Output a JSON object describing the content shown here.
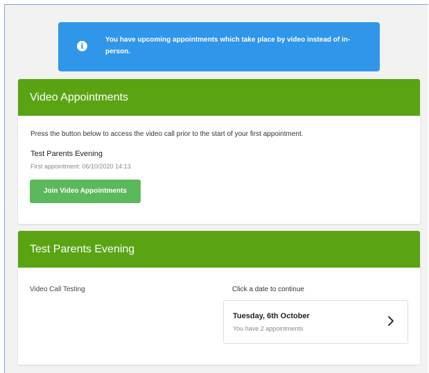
{
  "alert": {
    "icon": "info-icon",
    "icon_glyph": "i",
    "message": "You have upcoming appointments which take place by video instead of in-person."
  },
  "video_card": {
    "title": "Video Appointments",
    "description": "Press the button below to access the video call prior to the start of your first appointment.",
    "event_name": "Test Parents Evening",
    "first_appointment": "First appointment: 06/10/2020 14:13",
    "join_button_label": "Join Video Appointments"
  },
  "evening_card": {
    "title": "Test Parents Evening",
    "left_label": "Video Call Testing",
    "date_prompt": "Click a date to continue",
    "date_option": {
      "date": "Tuesday, 6th October",
      "subtitle": "You have 2 appointments",
      "icon": "chevron-right-icon"
    }
  },
  "colors": {
    "header_green": "#5aa414",
    "button_green": "#5cb85c",
    "alert_blue": "#2f96ea",
    "page_background": "#f2f2f2"
  }
}
